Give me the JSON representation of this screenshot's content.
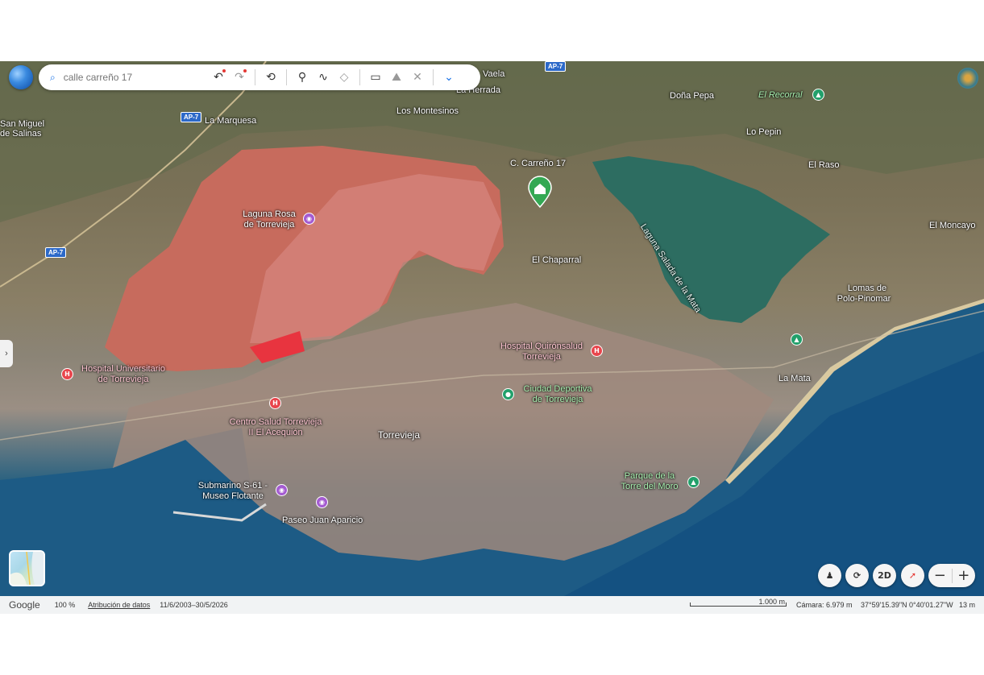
{
  "search": {
    "placeholder": "calle carreño 17"
  },
  "toolbar": {
    "undo_icon": "undo-icon",
    "redo_icon": "redo-icon",
    "history_icon": "history-icon",
    "pin_icon": "placemark-icon",
    "path_icon": "path-icon",
    "polygon_icon": "polygon-icon",
    "ruler_icon": "ruler-icon",
    "image_overlay_icon": "image-overlay-icon",
    "tools_icon": "tools-icon",
    "more_icon": "chevron-down-icon"
  },
  "map": {
    "places": [
      "Doña Pepa",
      "El Recorral",
      "Lo Pepin",
      "El Raso",
      "El Moncayo",
      "Lomas de",
      "Polo-Pinomar",
      "La Mata",
      "Torrevieja",
      "El Chaparral",
      "Los Montesinos",
      "La Marquesa",
      "San Miguel",
      "de Salinas",
      "La Herrada",
      "Vaela"
    ],
    "address_label": "C. Carreño 17",
    "lagoon_pink": "Laguna Rosa",
    "lagoon_pink_2": "de Torrevieja",
    "lagoon_green": "Laguna Salada de la Mata",
    "hospital_1a": "Hospital Universitario",
    "hospital_1b": "de Torrevieja",
    "hospital_2a": "Hospital Quirónsalud",
    "hospital_2b": "Torrevieja",
    "health_center_a": "Centro Salud Torrevieja",
    "health_center_b": "II El Acequión",
    "sport_a": "Ciudad Deportiva",
    "sport_b": "de Torrevieja",
    "museum_a": "Submarino S-61 -",
    "museum_b": "Museo Flotante",
    "paseo": "Paseo Juan Aparicio",
    "park_a": "Parque de la",
    "park_b": "Torre del Moro",
    "road_shields": [
      "AP-7",
      "AP-7",
      "AP-7"
    ]
  },
  "controls": {
    "mode_2d": "2D",
    "zoom_out": "−",
    "zoom_in": "+"
  },
  "status": {
    "brand": "Google",
    "zoom_pct": "100 %",
    "attribution": "Atribución de datos",
    "dates": "11/6/2003–30/5/2026",
    "scale": "1.000 m",
    "camera": "Cámara: 6.979 m",
    "coords": "37°59'15.39\"N 0°40'01.27\"W",
    "altitude": "13 m"
  },
  "colors": {
    "pink_lagoon": "#c96a5f",
    "green_lagoon": "#2f6b5e",
    "sea": "#1b5a82",
    "accent": "#1a73e8"
  }
}
